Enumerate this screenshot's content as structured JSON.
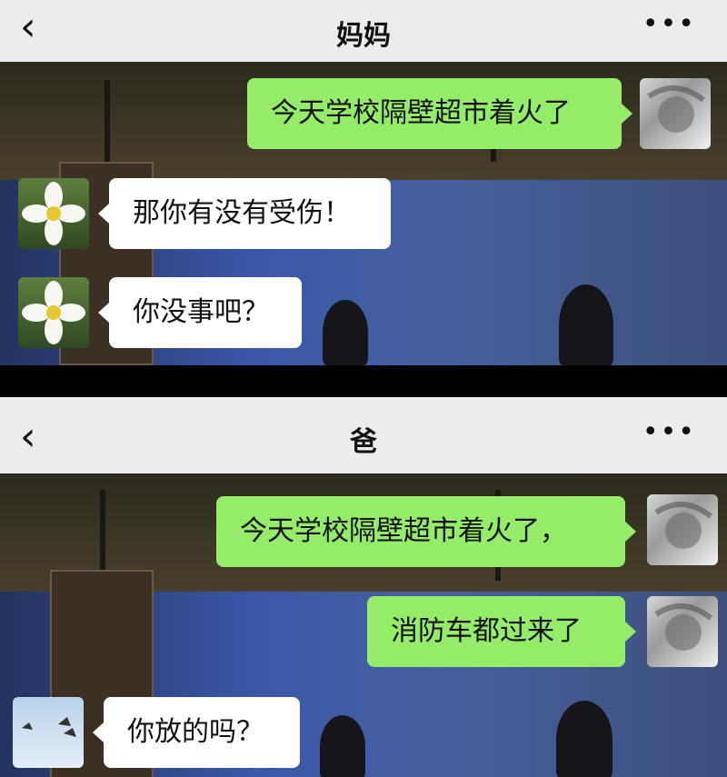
{
  "screens": [
    {
      "title": "妈妈",
      "back_icon": "‹",
      "more_icon": "•••",
      "messages": [
        {
          "side": "out",
          "text": "今天学校隔壁超市着火了"
        },
        {
          "side": "in",
          "text": "那你有没有受伤！"
        },
        {
          "side": "in",
          "text": "你没事吧？"
        }
      ]
    },
    {
      "title": "爸",
      "back_icon": "‹",
      "more_icon": "•••",
      "messages": [
        {
          "side": "out",
          "text": "今天学校隔壁超市着火了，"
        },
        {
          "side": "out",
          "text": "消防车都过来了"
        },
        {
          "side": "in",
          "text": "你放的吗？"
        }
      ]
    }
  ],
  "colors": {
    "header_bg": "#ececec",
    "outgoing_bubble": "#95ec69",
    "incoming_bubble": "#ffffff"
  },
  "icons": [
    "back-icon",
    "more-options-icon",
    "flower-avatar-icon",
    "bird-avatar-icon",
    "user-photo-avatar-icon"
  ]
}
